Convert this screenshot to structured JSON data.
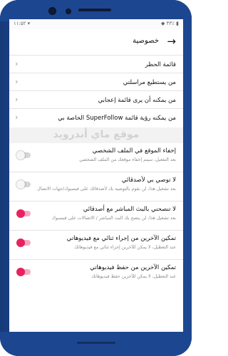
{
  "status": {
    "left": "۱۱:۵۲ ▾",
    "right": "◆ ۴۳٪ ▮"
  },
  "header": {
    "title": "خصوصية",
    "back_icon": "arrow-back-icon"
  },
  "nav_rows": [
    {
      "label": "قائمة الحظر"
    },
    {
      "label": "من يستطيع مراسلتي"
    },
    {
      "label": "من يمكنه أن يرى قائمة إعجابي"
    },
    {
      "label": "من يمكنه رؤية قائمة SuperFollow الخاصة بي"
    }
  ],
  "watermark": "موقع ماي أندرويد",
  "toggles": [
    {
      "label": "إخفاء الموقع في الملف الشخصي",
      "desc": "بعد التفعيل، سيتم إخفاء موقعك من الملف الشخصي",
      "on": false
    },
    {
      "label": "لا توصي بي لأصدقائي",
      "desc": "بعد تشغيل هذا، لن نقوم بالتوصية بك لأصدقائك على فيسبوك/جهات الاتصال",
      "on": false
    },
    {
      "label": "لا تنصحني بالبث المباشر مع أصدقائي",
      "desc": "بعد تشغيل هذا، لن ينصح بك البث المباشر / الاتصالات على فيسبوك",
      "on": true
    },
    {
      "label": "تمكين الآخرين من إجراء ثنائي مع فيديوهاتي",
      "desc": "عند التعطيل، لا يمكن للآخرين إجراء ثنائي مع فيديوهاتك",
      "on": true
    },
    {
      "label": "تمكين الآخرين من حفظ فيديوهاتي",
      "desc": "عند التعطيل، لا يمكن للآخرين حفظ فيديوهاتك",
      "on": true
    }
  ],
  "colors": {
    "accent": "#e8225f",
    "frame": "#1d4690"
  }
}
